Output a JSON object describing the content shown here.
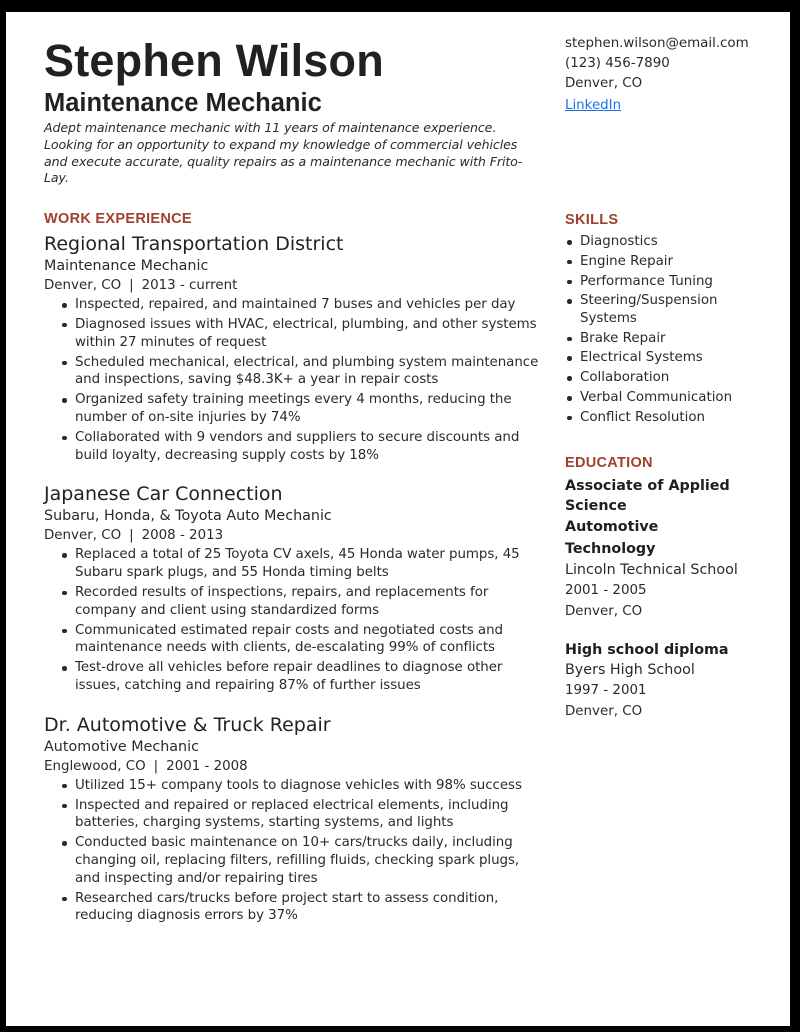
{
  "header": {
    "name": "Stephen Wilson",
    "headline": "Maintenance Mechanic",
    "summary": "Adept maintenance mechanic with 11 years of maintenance experience. Looking for an opportunity to expand my knowledge of commercial vehicles and execute accurate, quality repairs as a maintenance mechanic with Frito-Lay."
  },
  "contact": {
    "email": "stephen.wilson@email.com",
    "phone": "(123) 456-7890",
    "location": "Denver, CO",
    "linkedin_label": "LinkedIn",
    "link_color": "#1a73e8"
  },
  "theme": {
    "accent": "#a0402f",
    "text": "#2a2a2a"
  },
  "work": {
    "title": "WORK EXPERIENCE",
    "separator": "|",
    "jobs": [
      {
        "company": "Regional Transportation District",
        "title": "Maintenance Mechanic",
        "location": "Denver, CO",
        "dates": "2013 - current",
        "bullets": [
          "Inspected, repaired, and maintained 7 buses and vehicles per day",
          "Diagnosed issues with HVAC, electrical, plumbing, and other systems within 27 minutes of request",
          "Scheduled mechanical, electrical, and plumbing system maintenance and inspections, saving $48.3K+ a year in repair costs",
          "Organized safety training meetings every 4 months, reducing the number of on-site injuries by 74%",
          "Collaborated with 9 vendors and suppliers to secure discounts and build loyalty, decreasing supply costs by 18%"
        ]
      },
      {
        "company": "Japanese Car Connection",
        "title": "Subaru, Honda, & Toyota Auto Mechanic",
        "location": "Denver, CO",
        "dates": "2008 - 2013",
        "bullets": [
          "Replaced a total of 25 Toyota CV axels, 45 Honda water pumps, 45 Subaru spark plugs, and 55 Honda timing belts",
          "Recorded results of inspections, repairs, and replacements for company and client using standardized forms",
          "Communicated estimated repair costs and negotiated costs and maintenance needs with clients, de-escalating 99% of conflicts",
          "Test-drove all vehicles before repair deadlines to diagnose other issues, catching and repairing 87% of further issues"
        ]
      },
      {
        "company": "Dr. Automotive & Truck Repair",
        "title": "Automotive Mechanic",
        "location": "Englewood, CO",
        "dates": "2001 - 2008",
        "bullets": [
          "Utilized 15+ company tools to diagnose vehicles with 98% success",
          "Inspected and repaired or replaced electrical elements, including batteries, charging systems, starting systems, and lights",
          "Conducted basic maintenance on 10+ cars/trucks daily, including changing oil, replacing filters, refilling fluids, checking spark plugs, and inspecting and/or repairing tires",
          "Researched cars/trucks before project start to assess condition, reducing diagnosis errors by 37%"
        ]
      }
    ]
  },
  "skills": {
    "title": "SKILLS",
    "items": [
      "Diagnostics",
      "Engine Repair",
      "Performance Tuning",
      "Steering/Suspension Systems",
      "Brake Repair",
      "Electrical Systems",
      "Collaboration",
      "Verbal Communication",
      "Conflict Resolution"
    ]
  },
  "education": {
    "title": "EDUCATION",
    "entries": [
      {
        "degree": "Associate of Applied Science",
        "field": "Automotive Technology",
        "school": "Lincoln Technical School",
        "dates": "2001 - 2005",
        "location": "Denver, CO"
      },
      {
        "degree": "High school diploma",
        "field": "",
        "school": "Byers High School",
        "dates": "1997 - 2001",
        "location": "Denver, CO"
      }
    ]
  }
}
